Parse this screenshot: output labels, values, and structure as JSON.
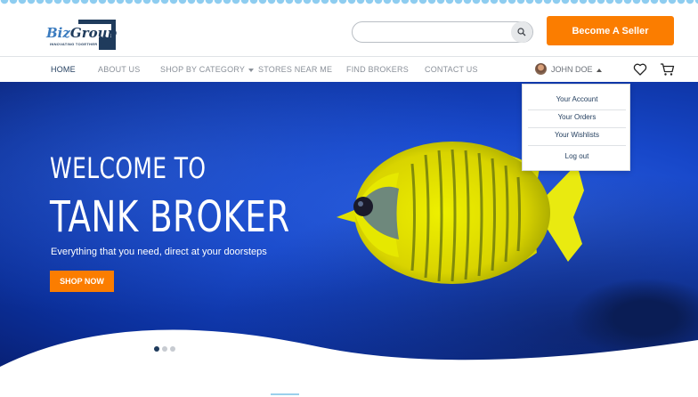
{
  "header": {
    "logo": {
      "name_prefix": "Biz",
      "name_suffix": "Group",
      "tagline": "INNOVATING TOGETHER"
    },
    "search": {
      "placeholder": "",
      "value": "",
      "icon": "search-icon"
    },
    "seller_button": "Become A Seller"
  },
  "nav": {
    "items": [
      {
        "label": "HOME",
        "active": true
      },
      {
        "label": "ABOUT US",
        "active": false
      },
      {
        "label": "SHOP BY CATEGORY",
        "active": false,
        "has_caret": true
      },
      {
        "label": "STORES NEAR ME",
        "active": false
      },
      {
        "label": "FIND BROKERS",
        "active": false
      },
      {
        "label": "CONTACT US",
        "active": false
      }
    ],
    "user": {
      "name": "JOHN DOE",
      "icon": "avatar"
    },
    "wishlist_icon": "heart-icon",
    "cart_icon": "cart-icon"
  },
  "user_menu": {
    "items": [
      "Your Account",
      "Your Orders",
      "Your Wishlists",
      "Log out"
    ]
  },
  "hero": {
    "welcome": "WELCOME TO",
    "title": "TANK BROKER",
    "subtitle": "Everything that you need, direct at your doorsteps",
    "cta": "SHOP NOW",
    "slides_total": 3,
    "active_slide": 1
  },
  "colors": {
    "accent": "#fb7d00",
    "brand": "#1f3b5c",
    "hero_blue": "#1747c9"
  }
}
